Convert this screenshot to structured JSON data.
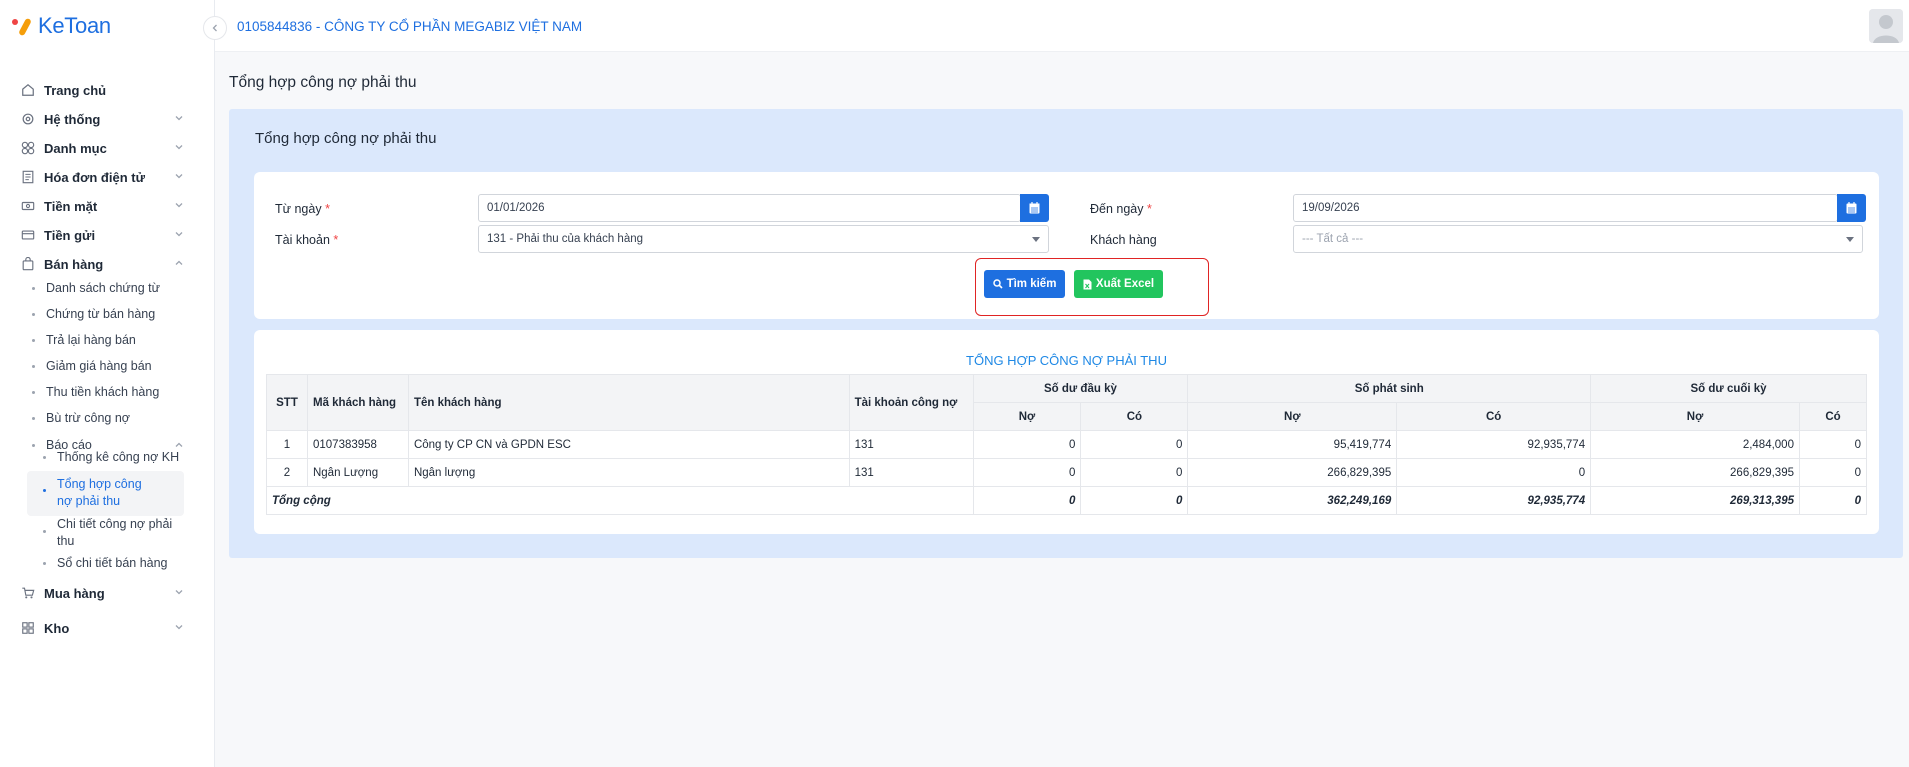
{
  "app": {
    "logo_text": "KeToan",
    "company": "0105844836 - CÔNG TY CỔ PHẦN MEGABIZ VIỆT NAM"
  },
  "sidebar": {
    "home": "Trang chủ",
    "system": "Hệ thống",
    "catalog": "Danh mục",
    "einvoice": "Hóa đơn điện tử",
    "cash": "Tiền mặt",
    "deposit": "Tiền gửi",
    "sales": "Bán hàng",
    "sales_items": [
      "Danh sách chứng từ",
      "Chứng từ bán hàng",
      "Trả lại hàng bán",
      "Giảm giá hàng bán",
      "Thu tiền khách hàng",
      "Bù trừ công nợ"
    ],
    "reports": "Báo cáo",
    "report_items": [
      "Thống kê công nợ KH",
      "Tổng hợp công nợ phải thu",
      "Chi tiết công nợ phải thu",
      "Sổ chi tiết bán hàng"
    ],
    "purchase": "Mua hàng",
    "warehouse": "Kho"
  },
  "page": {
    "title": "Tổng hợp công nợ phải thu",
    "card_title": "Tổng hợp công nợ phải thu"
  },
  "form": {
    "from_label": "Từ ngày",
    "from_value": "01/01/2026",
    "to_label": "Đến ngày",
    "to_value": "19/09/2026",
    "account_label": "Tài khoản",
    "account_value": "131 - Phải thu của khách hàng",
    "customer_label": "Khách hàng",
    "customer_placeholder": "--- Tất cả ---",
    "required_mark": "*",
    "search_button": "Tìm kiếm",
    "excel_button": "Xuất Excel"
  },
  "table": {
    "title": "TỔNG HỢP CÔNG NỢ PHẢI THU",
    "headers": {
      "stt": "STT",
      "code": "Mã khách hàng",
      "name": "Tên khách hàng",
      "account": "Tài khoản công nợ",
      "opening": "Số dư đầu kỳ",
      "movement": "Số phát sinh",
      "closing": "Số dư cuối kỳ",
      "debit": "Nợ",
      "credit": "Có"
    },
    "rows": [
      {
        "stt": "1",
        "code": "0107383958",
        "name": "Công ty CP CN và GPDN ESC",
        "account": "131",
        "open_debit": "0",
        "open_credit": "0",
        "mov_debit": "95,419,774",
        "mov_credit": "92,935,774",
        "close_debit": "2,484,000",
        "close_credit": "0"
      },
      {
        "stt": "2",
        "code": "Ngân Lượng",
        "name": "Ngân lượng",
        "account": "131",
        "open_debit": "0",
        "open_credit": "0",
        "mov_debit": "266,829,395",
        "mov_credit": "0",
        "close_debit": "266,829,395",
        "close_credit": "0"
      }
    ],
    "total": {
      "label": "Tổng cộng",
      "open_debit": "0",
      "open_credit": "0",
      "mov_debit": "362,249,169",
      "mov_credit": "92,935,774",
      "close_debit": "269,313,395",
      "close_credit": "0"
    }
  },
  "colors": {
    "primary": "#1e6fe0",
    "success": "#22c55e",
    "highlight": "#e02424",
    "panel": "#dbe8fc"
  }
}
